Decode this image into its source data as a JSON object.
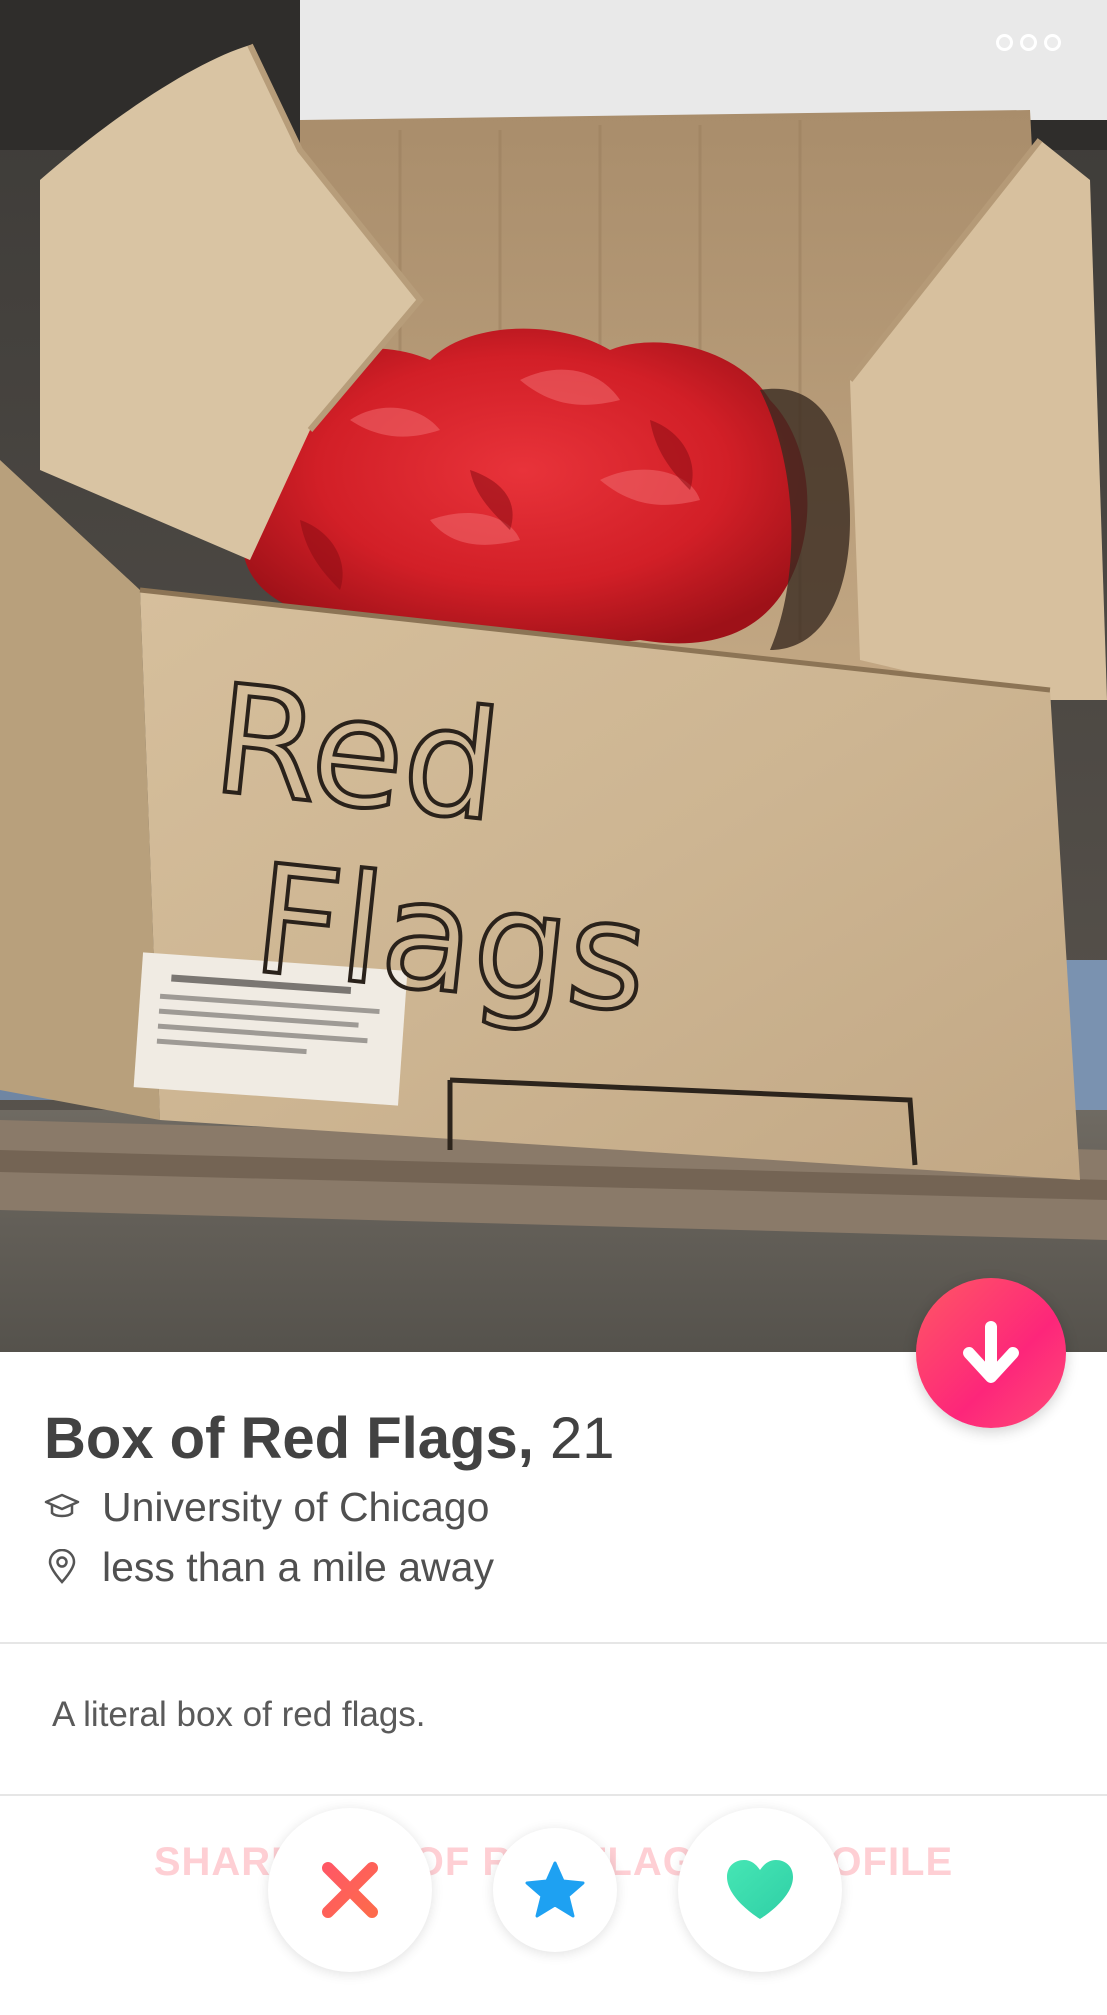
{
  "profile": {
    "name": "Box of Red Flags,",
    "age": "21",
    "school": "University of Chicago",
    "distance": "less than a mile away",
    "bio": "A literal box of red flags."
  },
  "photo": {
    "handwriting_line1": "Red",
    "handwriting_line2": "Flags"
  },
  "actions": {
    "share_label": "SHARE BOX OF RED FLAGS'S PROFILE"
  },
  "icons": {
    "more": "more-options-icon",
    "collapse": "arrow-down-icon",
    "school": "graduation-cap-icon",
    "distance": "location-pin-icon",
    "nope": "close-x-icon",
    "super_like": "star-icon",
    "like": "heart-icon"
  },
  "colors": {
    "accent_gradient_start": "#ff5864",
    "accent_gradient_end": "#fd267a",
    "super_like_blue": "#1ea1f2",
    "like_green": "#3fe0b0",
    "text_primary": "#424242"
  }
}
